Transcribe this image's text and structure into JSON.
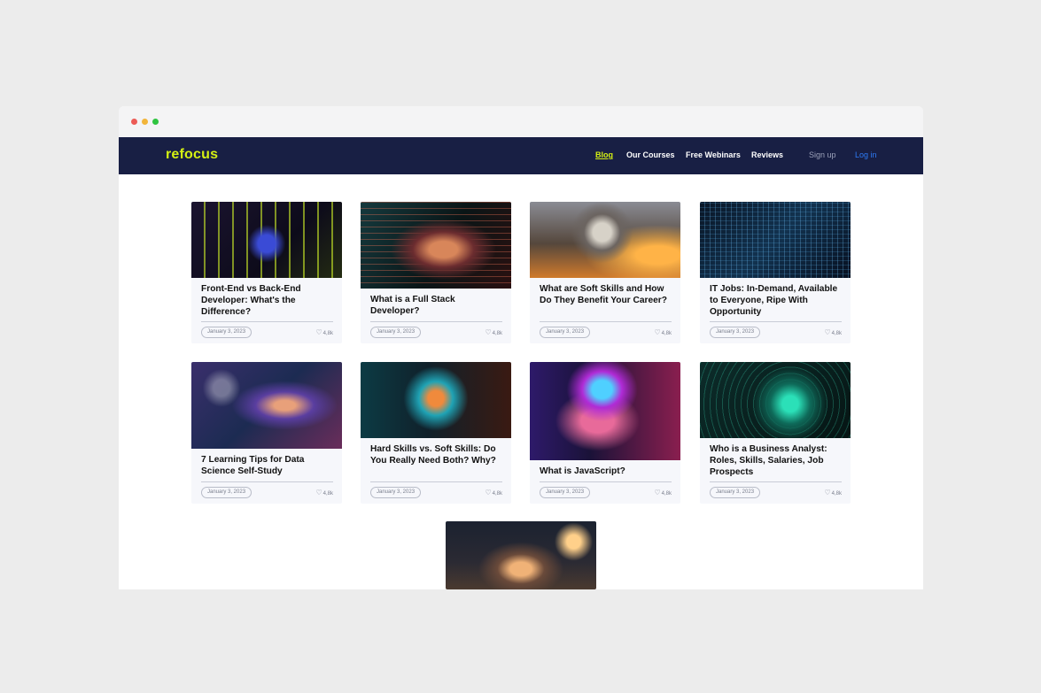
{
  "nav": {
    "logo": "refocus",
    "links": [
      "Blog",
      "Our Courses",
      "Free Webinars",
      "Reviews"
    ],
    "signup": "Sign up",
    "login": "Log in"
  },
  "colors": {
    "navbar": "#181f44",
    "accent": "#d4f013",
    "login": "#2e7bf6"
  },
  "posts": [
    {
      "title": "Front-End vs Back-End Developer: What's the Difference?",
      "date": "January 3, 2023",
      "likes": "4,8k"
    },
    {
      "title": "What is a Full Stack Developer?",
      "date": "January 3, 2023",
      "likes": "4,8k"
    },
    {
      "title": "What are Soft Skills and How Do They Benefit Your Career?",
      "date": "January 3, 2023",
      "likes": "4,8k"
    },
    {
      "title": "IT Jobs: In-Demand, Available to Everyone, Ripe With Opportunity",
      "date": "January 3, 2023",
      "likes": "4,8k"
    },
    {
      "title": "7 Learning Tips for Data Science Self-Study",
      "date": "January 3, 2023",
      "likes": "4,8k"
    },
    {
      "title": "Hard Skills vs. Soft Skills: Do You Really Need Both? Why?",
      "date": "January 3, 2023",
      "likes": "4,8k"
    },
    {
      "title": "What is JavaScript?",
      "date": "January 3, 2023",
      "likes": "4,8k"
    },
    {
      "title": "Who is a Business Analyst: Roles, Skills, Salaries, Job Prospects",
      "date": "January 3, 2023",
      "likes": "4,8k"
    }
  ]
}
